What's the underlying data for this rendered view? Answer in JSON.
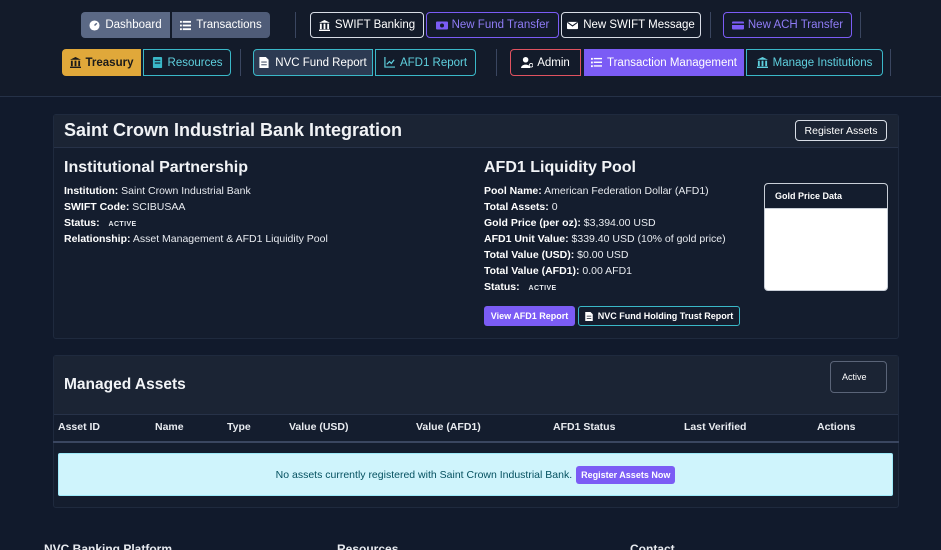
{
  "nav": {
    "dashboard": "Dashboard",
    "transactions": "Transactions",
    "swift_banking": "SWIFT Banking",
    "new_fund_transfer": "New Fund Transfer",
    "new_swift_message": "New SWIFT Message",
    "new_ach_transfer": "New ACH Transfer",
    "treasury": "Treasury",
    "resources": "Resources",
    "nvc_fund_report": "NVC Fund Report",
    "afd1_report": "AFD1 Report",
    "admin": "Admin",
    "transaction_management": "Transaction Management",
    "manage_institutions": "Manage Institutions"
  },
  "integration": {
    "title": "Saint Crown Industrial Bank Integration",
    "register_button": "Register Assets",
    "partnership": {
      "heading": "Institutional Partnership",
      "institution_label": "Institution:",
      "institution_value": "Saint Crown Industrial Bank",
      "swift_label": "SWIFT Code:",
      "swift_value": "SCIBUSAA",
      "status_label": "Status:",
      "status_value": "ACTIVE",
      "relationship_label": "Relationship:",
      "relationship_value": "Asset Management & AFD1 Liquidity Pool"
    },
    "pool": {
      "heading": "AFD1 Liquidity Pool",
      "pool_name_label": "Pool Name:",
      "pool_name_value": "American Federation Dollar (AFD1)",
      "total_assets_label": "Total Assets:",
      "total_assets_value": "0",
      "gold_price_label": "Gold Price (per oz):",
      "gold_price_value": "$3,394.00 USD",
      "unit_value_label": "AFD1 Unit Value:",
      "unit_value_value": "$339.40 USD (10% of gold price)",
      "total_usd_label": "Total Value (USD):",
      "total_usd_value": "$0.00 USD",
      "total_afd1_label": "Total Value (AFD1):",
      "total_afd1_value": "0.00 AFD1",
      "status_label": "Status:",
      "status_value": "ACTIVE",
      "view_report_button": "View AFD1 Report",
      "trust_report_button": "NVC Fund Holding Trust Report",
      "gold_panel_title": "Gold Price Data"
    }
  },
  "assets": {
    "title": "Managed Assets",
    "status_select": "Active",
    "columns": [
      "Asset ID",
      "Name",
      "Type",
      "Value (USD)",
      "Value (AFD1)",
      "AFD1 Status",
      "Last Verified",
      "Actions"
    ],
    "empty_message": "No assets currently registered with Saint Crown Industrial Bank.",
    "empty_action": "Register Assets Now"
  },
  "footer": {
    "brand": "NVC Banking Platform",
    "resources": "Resources",
    "contact": "Contact"
  },
  "colors": {
    "page_bg": "#111a2c",
    "treasury": "#e0a83a",
    "transaction_management": "#7b5cf5",
    "teal_accent": "#3ab8c8",
    "purple_accent": "#7b5cf5",
    "alert_bg": "#cff4fc"
  }
}
